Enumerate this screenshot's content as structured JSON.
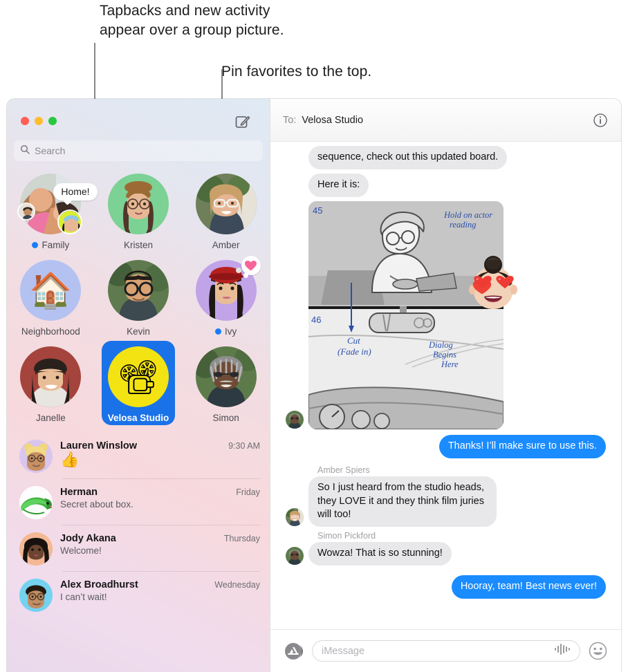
{
  "callouts": [
    {
      "text": "Tapbacks and new activity\nappear over a group picture.",
      "name": "callout-tapbacks"
    },
    {
      "text": "Pin favorites to the top.",
      "name": "callout-pin-favorites"
    }
  ],
  "window": {
    "traffic_lights": {
      "close": "close-button",
      "minimize": "minimize-button",
      "zoom": "zoom-button"
    },
    "compose_icon": "compose-icon"
  },
  "sidebar": {
    "search": {
      "placeholder": "Search",
      "icon": "search-icon"
    },
    "pinned": [
      {
        "label": "Family",
        "unread": true,
        "tapback_text": "Home!",
        "avatar_kind": "group-photo"
      },
      {
        "label": "Kristen",
        "unread": false,
        "avatar_kind": "memoji-green"
      },
      {
        "label": "Amber",
        "unread": false,
        "avatar_kind": "photo-amber"
      },
      {
        "label": "Neighborhood",
        "unread": false,
        "avatar_kind": "house-emoji"
      },
      {
        "label": "Kevin",
        "unread": false,
        "avatar_kind": "photo-kevin"
      },
      {
        "label": "Ivy",
        "unread": true,
        "tapback_heart": "heart-tapback",
        "avatar_kind": "memoji-purple"
      },
      {
        "label": "Janelle",
        "unread": false,
        "avatar_kind": "photo-janelle"
      },
      {
        "label": "Velosa Studio",
        "unread": false,
        "selected": true,
        "avatar_kind": "projector-emoji"
      },
      {
        "label": "Simon",
        "unread": false,
        "avatar_kind": "photo-simon"
      }
    ],
    "conversations": [
      {
        "name": "Lauren Winslow",
        "time": "9:30 AM",
        "preview": "👍",
        "preview_is_emoji": true,
        "avatar_kind": "memoji-lauren"
      },
      {
        "name": "Herman",
        "time": "Friday",
        "preview": "Secret about box.",
        "preview_is_emoji": false,
        "avatar_kind": "iguana-photo"
      },
      {
        "name": "Jody Akana",
        "time": "Thursday",
        "preview": "Welcome!",
        "preview_is_emoji": false,
        "avatar_kind": "memoji-jody"
      },
      {
        "name": "Alex Broadhurst",
        "time": "Wednesday",
        "preview": "I can’t wait!",
        "preview_is_emoji": false,
        "avatar_kind": "memoji-alex"
      }
    ]
  },
  "thread": {
    "to_label": "To:",
    "to_value": "Velosa Studio",
    "info_icon": "info-icon",
    "messages": [
      {
        "kind": "text",
        "dir": "in",
        "text": "sequence, check out this updated board.",
        "sender": null
      },
      {
        "kind": "text",
        "dir": "in",
        "text": "Here it is:",
        "sender": null
      },
      {
        "kind": "image",
        "dir": "in",
        "sender": null,
        "avatar_kind": "photo-simon",
        "storyboard": {
          "panel_labels": [
            "45",
            "46"
          ],
          "annotations": [
            "Hold on actor reading",
            "Cut (Fade in)",
            "Dialog Begins Here"
          ]
        },
        "reaction": "heart-eyes-memoji"
      },
      {
        "kind": "text",
        "dir": "out",
        "text": "Thanks! I’ll make sure to use this.",
        "sender": null
      },
      {
        "kind": "text",
        "dir": "in",
        "text": "So I just heard from the studio heads, they LOVE it and they think film juries will too!",
        "sender": "Amber Spiers",
        "avatar_kind": "photo-amber"
      },
      {
        "kind": "text",
        "dir": "in",
        "text": "Wowza! That is so stunning!",
        "sender": "Simon Pickford",
        "avatar_kind": "photo-simon"
      },
      {
        "kind": "text",
        "dir": "out",
        "text": "Hooray, team! Best news ever!",
        "sender": null
      }
    ],
    "input": {
      "placeholder": "iMessage",
      "apps_icon": "app-store-icon",
      "audio_icon": "audio-waveform-icon",
      "emoji_icon": "emoji-smiley-icon"
    }
  },
  "colors": {
    "accent_blue": "#1a8cff",
    "selected_pin": "#1a72e8",
    "unread_dot": "#1a7cf8",
    "bubble_in": "#e8e8ea",
    "callout_line": "#86868b"
  }
}
